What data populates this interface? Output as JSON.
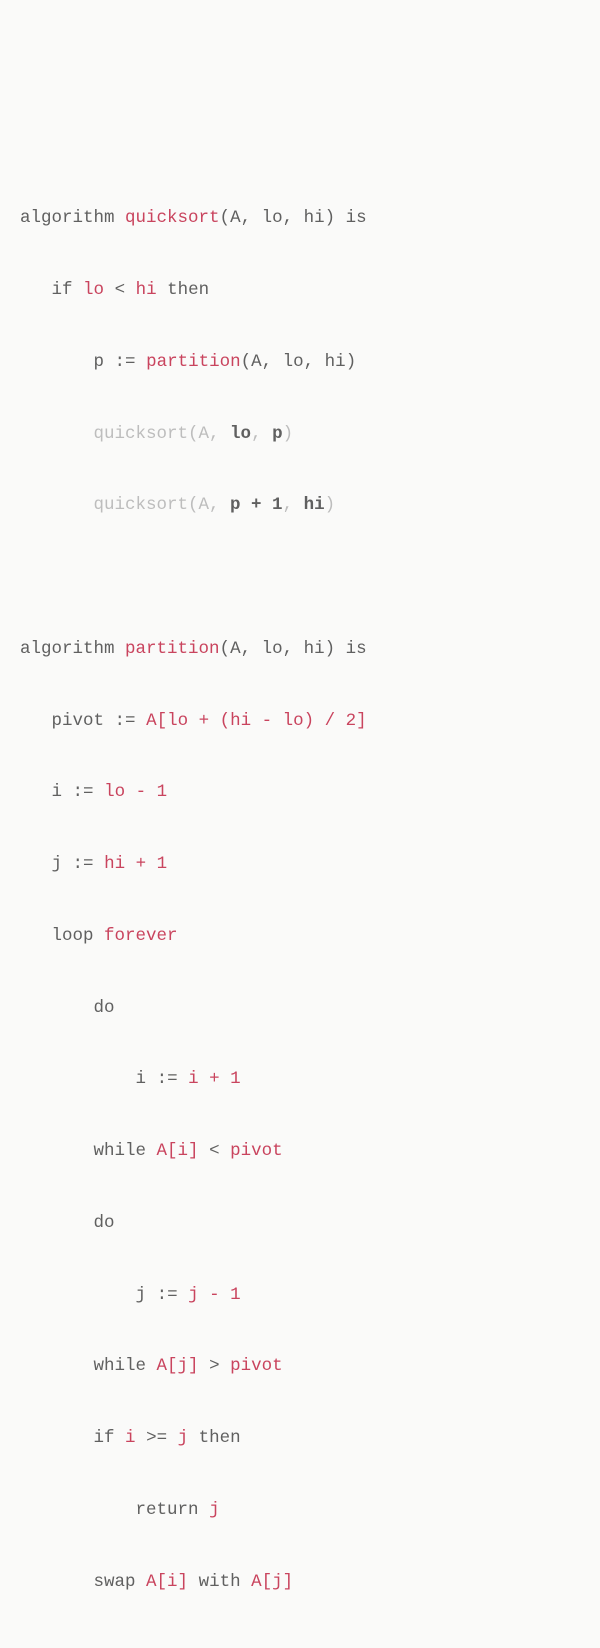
{
  "tokens": {
    "kw_algorithm": "algorithm",
    "kw_is": "is",
    "kw_if": "if",
    "kw_then": "then",
    "kw_loop": "loop",
    "kw_forever": "forever",
    "kw_do": "do",
    "kw_while": "while",
    "kw_return": "return",
    "kw_swap": "swap",
    "kw_with": "with",
    "fn_quicksort": "quicksort",
    "fn_partition": "partition",
    "call_qs_prefix_gray": "quicksort(A, ",
    "call_qs_close": ")",
    "id_A": "A",
    "id_lo": "lo",
    "id_hi": "hi",
    "id_p": "p",
    "id_i": "i",
    "id_j": "j",
    "id_pivot": "pivot",
    "comma_sp": ", ",
    "lparen": "(",
    "rparen": ")",
    "lbrack": "[",
    "rbrack": "]",
    "assign": ":=",
    "lt": "<",
    "gt": ">",
    "gte": ">=",
    "plus": "+",
    "minus": "-",
    "slash": "/",
    "one": "1",
    "two": "2",
    "sp": " ",
    "expr_p_plus_1": "p + 1",
    "expr_i_plus_1": "i + 1",
    "expr_j_minus_1": "j - 1",
    "hoare_expr": "A[lo + (hi - lo) / 2]",
    "lo_minus_1": "lo - 1",
    "hi_plus_1": "hi + 1",
    "A_i": "A[i]",
    "A_j": "A[j]"
  }
}
